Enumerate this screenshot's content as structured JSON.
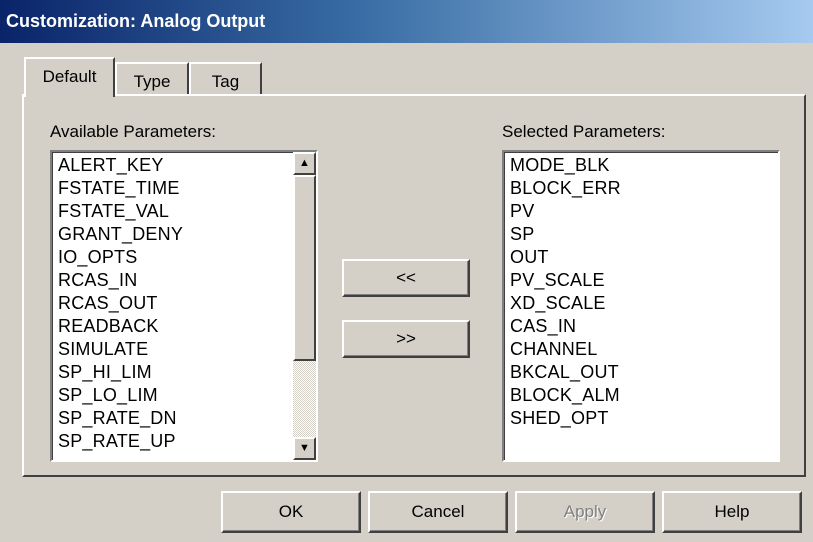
{
  "window": {
    "title": "Customization: Analog Output"
  },
  "tabs": [
    {
      "label": "Default",
      "active": true
    },
    {
      "label": "Type",
      "active": false
    },
    {
      "label": "Tag",
      "active": false
    }
  ],
  "available": {
    "label": "Available Parameters:",
    "items": [
      "ALERT_KEY",
      "FSTATE_TIME",
      "FSTATE_VAL",
      "GRANT_DENY",
      "IO_OPTS",
      "RCAS_IN",
      "RCAS_OUT",
      "READBACK",
      "SIMULATE",
      "SP_HI_LIM",
      "SP_LO_LIM",
      "SP_RATE_DN",
      "SP_RATE_UP"
    ]
  },
  "selected": {
    "label": "Selected Parameters:",
    "items": [
      "MODE_BLK",
      "BLOCK_ERR",
      "PV",
      "SP",
      "OUT",
      "PV_SCALE",
      "XD_SCALE",
      "CAS_IN",
      "CHANNEL",
      "BKCAL_OUT",
      "BLOCK_ALM",
      "SHED_OPT"
    ]
  },
  "move": {
    "add_label": "<<",
    "remove_label": ">>"
  },
  "footer": {
    "ok_label": "OK",
    "cancel_label": "Cancel",
    "apply_label": "Apply",
    "help_label": "Help"
  },
  "colors": {
    "face": "#d4d0c8",
    "title_start": "#0a246a",
    "title_end": "#a6caf0"
  },
  "icons": {
    "scroll_up": "up-arrow-icon",
    "scroll_down": "down-arrow-icon"
  }
}
